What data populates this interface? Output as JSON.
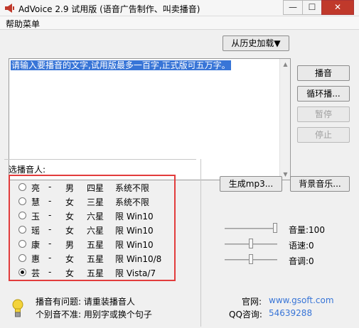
{
  "window": {
    "title": "AdVoice 2.9 试用版 (语音广告制作、叫卖播音)",
    "minimize_glyph": "—",
    "maximize_glyph": "☐",
    "close_glyph": "✕"
  },
  "menu": {
    "help": "帮助菜单"
  },
  "toolbar": {
    "history": "从历史加载▼"
  },
  "editor": {
    "text": "请输入要播音的文字,试用版最多一百字,正式版可五万字。"
  },
  "controls": {
    "play": "播音",
    "loop": "循环播...",
    "pause": "暂停",
    "stop": "停止",
    "make_mp3": "生成mp3...",
    "bg_music": "背景音乐..."
  },
  "voices": {
    "label": "选播音人:",
    "selected_index": 6,
    "items": [
      {
        "name": "亮",
        "dash": "-",
        "gender": "男",
        "stars": "四星",
        "system": "系统不限"
      },
      {
        "name": "慧",
        "dash": "-",
        "gender": "女",
        "stars": "三星",
        "system": "系统不限"
      },
      {
        "name": "玉",
        "dash": "-",
        "gender": "女",
        "stars": "六星",
        "system": "限 Win10"
      },
      {
        "name": "瑶",
        "dash": "-",
        "gender": "女",
        "stars": "六星",
        "system": "限 Win10"
      },
      {
        "name": "康",
        "dash": "-",
        "gender": "男",
        "stars": "五星",
        "system": "限 Win10"
      },
      {
        "name": "惠",
        "dash": "-",
        "gender": "女",
        "stars": "五星",
        "system": "限 Win10/8"
      },
      {
        "name": "芸",
        "dash": "-",
        "gender": "女",
        "stars": "五星",
        "system": "限 Vista/7"
      }
    ]
  },
  "sliders": {
    "volume": {
      "label": "音量:100",
      "level": 1.0
    },
    "speed": {
      "label": "语速:0",
      "level": 0.5
    },
    "pitch": {
      "label": "音调:0",
      "level": 0.5
    }
  },
  "footer": {
    "problem_line": "播音有问题: 请重装播音人",
    "accuracy_line": "个别音不准: 用别字或换个句子",
    "site_label": "官网:",
    "site_value": "www.gsoft.com",
    "qq_label": "QQ咨询:",
    "qq_value": "54639288"
  }
}
